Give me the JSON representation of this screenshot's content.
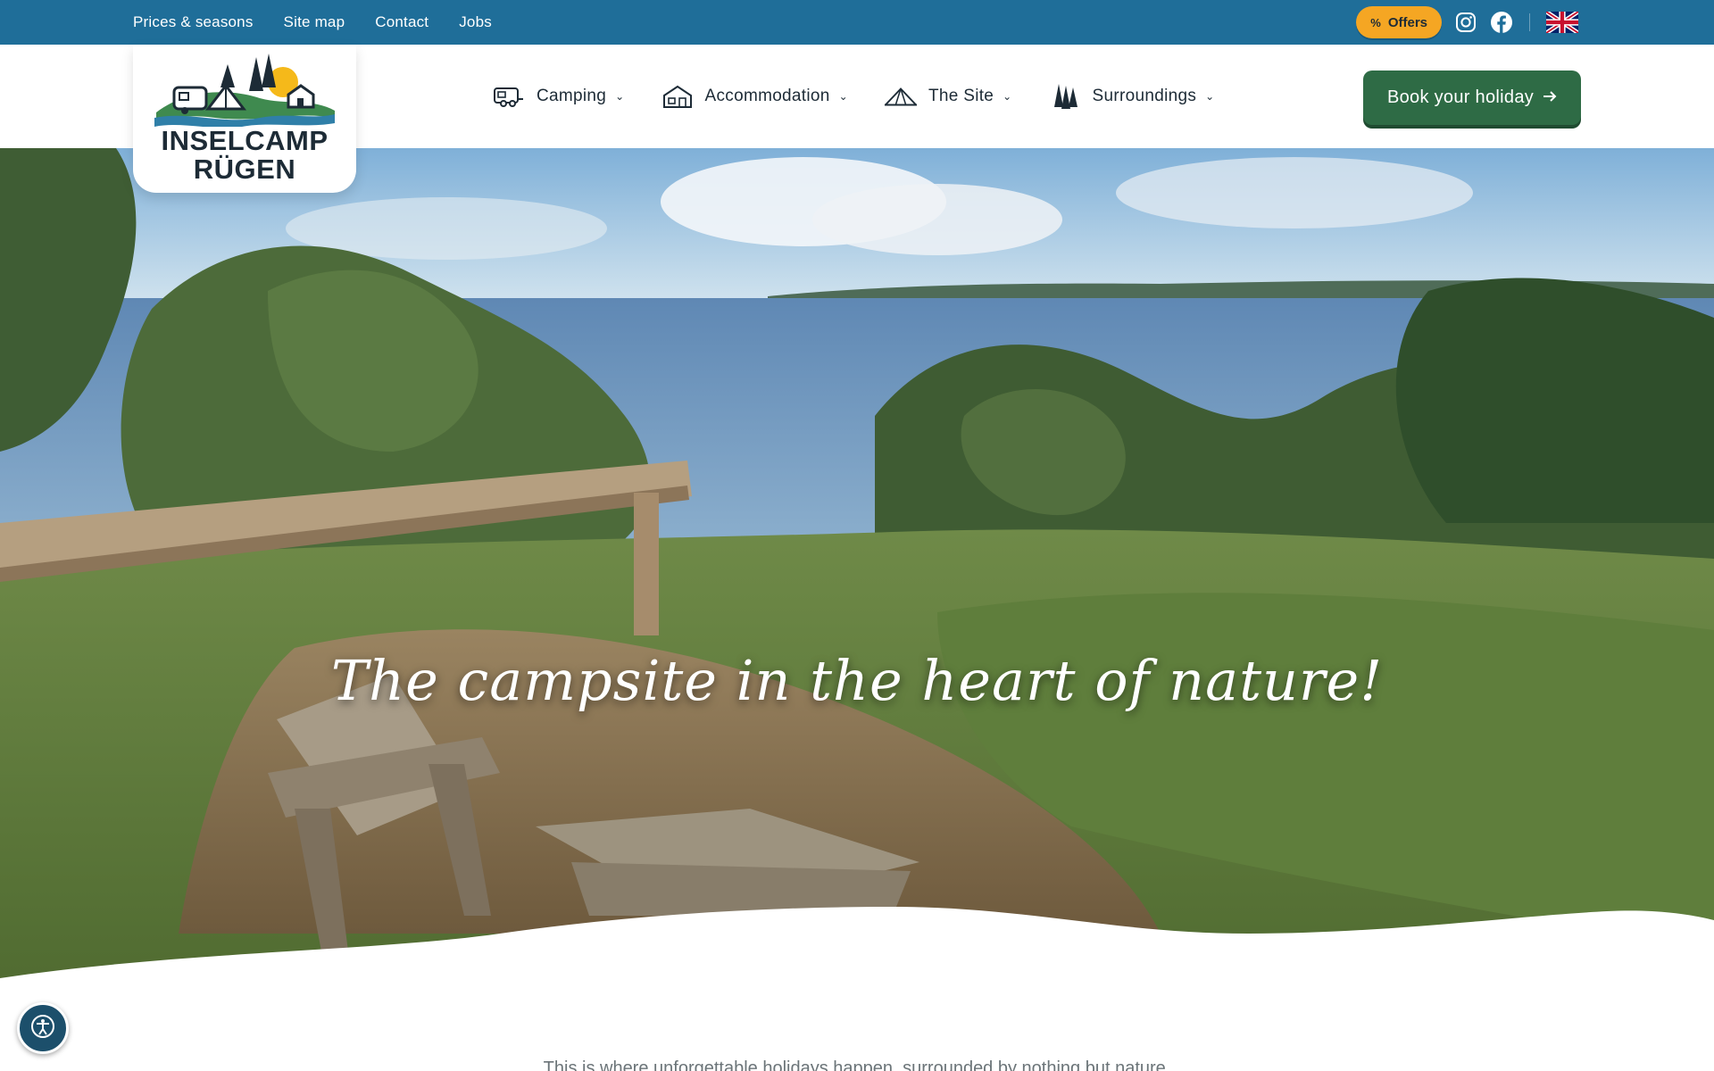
{
  "topbar": {
    "links": [
      "Prices & seasons",
      "Site map",
      "Contact",
      "Jobs"
    ],
    "offers_label": "Offers",
    "offers_icon": "percent-icon",
    "social": [
      "instagram-icon",
      "facebook-icon"
    ],
    "language_icon": "uk-flag-icon"
  },
  "logo": {
    "line1": "INSELCAMP",
    "line2": "RÜGEN"
  },
  "nav": [
    {
      "label": "Camping",
      "icon": "caravan-icon"
    },
    {
      "label": "Accommodation",
      "icon": "cabin-icon"
    },
    {
      "label": "The Site",
      "icon": "tent-icon"
    },
    {
      "label": "Surroundings",
      "icon": "trees-icon"
    }
  ],
  "book_button": {
    "label": "Book your holiday",
    "icon": "arrow-right-icon"
  },
  "hero": {
    "title": "The campsite in the heart of nature!"
  },
  "intro": {
    "text": "This is where unforgettable holidays happen, surrounded by nothing but nature."
  },
  "colors": {
    "topbar": "#1f6e99",
    "offers": "#f5a623",
    "book_button": "#2e6b45",
    "text_dark": "#1d2b36"
  }
}
